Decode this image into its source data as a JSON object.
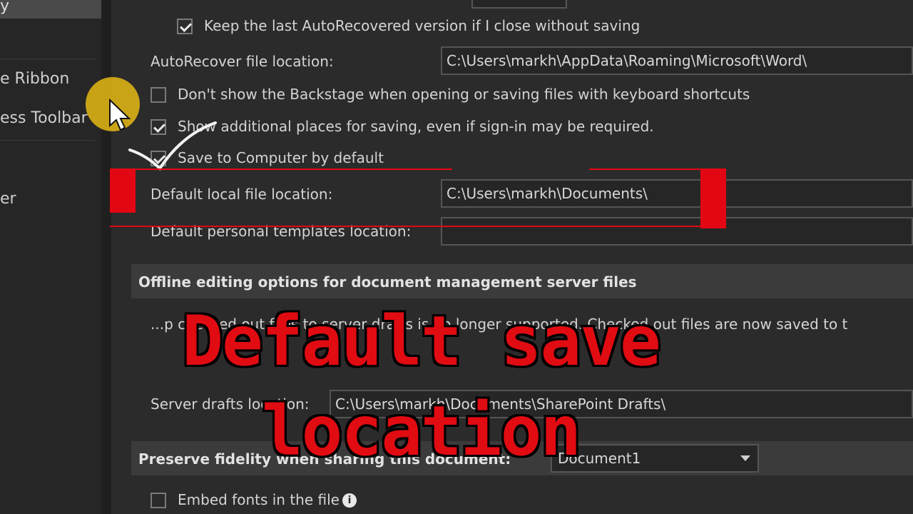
{
  "sidebar": {
    "top_item": "y",
    "items": [
      "e Ribbon",
      "ess Toolbar",
      "er"
    ]
  },
  "options": {
    "keep_last_autorecovered": {
      "label": "Keep the last AutoRecovered version if I close without saving",
      "checked": true
    },
    "autorecover_location": {
      "label": "AutoRecover file location:",
      "value": "C:\\Users\\markh\\AppData\\Roaming\\Microsoft\\Word\\"
    },
    "dont_show_backstage": {
      "label": "Don't show the Backstage when opening or saving files with keyboard shortcuts",
      "checked": false
    },
    "show_additional_places": {
      "label": "Show additional places for saving, even if sign-in may be required.",
      "checked": true
    },
    "save_to_computer": {
      "label": "Save to Computer by default",
      "checked": true
    },
    "default_local_location": {
      "label": "Default local file location:",
      "value": "C:\\Users\\markh\\Documents\\"
    },
    "default_templates_location": {
      "label": "Default personal templates location:",
      "value": ""
    }
  },
  "offline_section": {
    "header": "Offline editing options for document management server files",
    "note": "...p checked out files to server drafts is no longer supported. Checked out files are now saved to t",
    "server_drafts_label": "Server drafts location:",
    "server_drafts_value": "C:\\Users\\markh\\Documents\\SharePoint Drafts\\"
  },
  "preserve_section": {
    "header": "Preserve fidelity when sharing this document:",
    "document": "Document1"
  },
  "embed_fonts": {
    "label": "Embed fonts in the file",
    "checked": false
  },
  "overlay": {
    "line1": "Default save",
    "line2": "location"
  },
  "colors": {
    "accent_red": "#e30613",
    "cursor_halo": "#e6ba14"
  }
}
